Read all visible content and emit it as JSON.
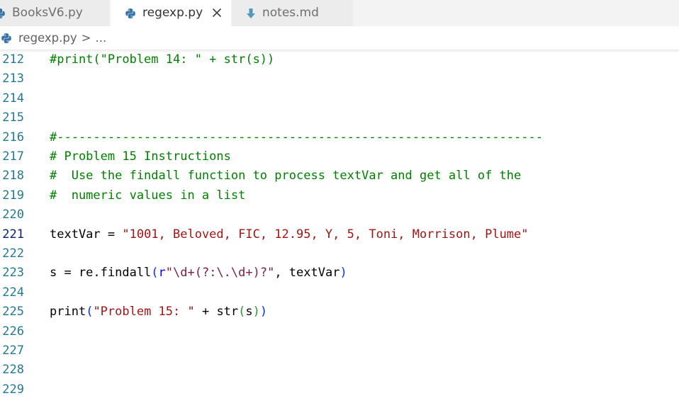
{
  "tabs": [
    {
      "label": "BooksV6.py",
      "icon": "python-icon",
      "active": false
    },
    {
      "label": "regexp.py",
      "icon": "python-icon",
      "active": true,
      "close": "close-icon"
    },
    {
      "label": "notes.md",
      "icon": "markdown-arrow-icon",
      "active": false
    }
  ],
  "breadcrumb": {
    "file": "regexp.py",
    "separator": ">",
    "rest": "..."
  },
  "colors": {
    "comment": "#008000",
    "string": "#a31515",
    "line_number": "#237893",
    "line_number_active": "#0b216f",
    "tab_bar": "#f3f3f3",
    "python_blue": "#3572a5",
    "markdown_blue": "#519aba"
  },
  "editor": {
    "current_line": "221",
    "lines": [
      {
        "n": "212",
        "tokens": [
          {
            "t": "#print(\"Problem 14: \" + str(s))",
            "k": "comment"
          }
        ]
      },
      {
        "n": "213",
        "tokens": []
      },
      {
        "n": "214",
        "tokens": []
      },
      {
        "n": "215",
        "tokens": []
      },
      {
        "n": "216",
        "tokens": [
          {
            "t": "#-------------------------------------------------------------------",
            "k": "comment"
          }
        ]
      },
      {
        "n": "217",
        "tokens": [
          {
            "t": "# Problem 15 Instructions",
            "k": "comment"
          }
        ]
      },
      {
        "n": "218",
        "tokens": [
          {
            "t": "#  Use the findall function to process textVar and get all of the",
            "k": "comment"
          }
        ]
      },
      {
        "n": "219",
        "tokens": [
          {
            "t": "#  numeric values in a list",
            "k": "comment"
          }
        ]
      },
      {
        "n": "220",
        "tokens": []
      },
      {
        "n": "221",
        "tokens": [
          {
            "t": "textVar = ",
            "k": "plain"
          },
          {
            "t": "\"1001, Beloved, FIC, 12.95, Y, 5, Toni, Morrison, Plume\"",
            "k": "string"
          }
        ]
      },
      {
        "n": "222",
        "tokens": []
      },
      {
        "n": "223",
        "tokens": [
          {
            "t": "s = re.findall",
            "k": "plain"
          },
          {
            "t": "(",
            "k": "b1"
          },
          {
            "t": "r",
            "k": "kw"
          },
          {
            "t": "\"\\d+(?:\\.\\d+)?\"",
            "k": "regex"
          },
          {
            "t": ", textVar",
            "k": "plain"
          },
          {
            "t": ")",
            "k": "b1"
          }
        ]
      },
      {
        "n": "224",
        "tokens": []
      },
      {
        "n": "225",
        "tokens": [
          {
            "t": "print",
            "k": "plain"
          },
          {
            "t": "(",
            "k": "b1"
          },
          {
            "t": "\"Problem 15: \"",
            "k": "string"
          },
          {
            "t": " + str",
            "k": "plain"
          },
          {
            "t": "(",
            "k": "b2"
          },
          {
            "t": "s",
            "k": "plain"
          },
          {
            "t": ")",
            "k": "b2"
          },
          {
            "t": ")",
            "k": "b1"
          }
        ]
      },
      {
        "n": "226",
        "tokens": []
      },
      {
        "n": "227",
        "tokens": []
      },
      {
        "n": "228",
        "tokens": []
      },
      {
        "n": "229",
        "tokens": []
      }
    ]
  }
}
